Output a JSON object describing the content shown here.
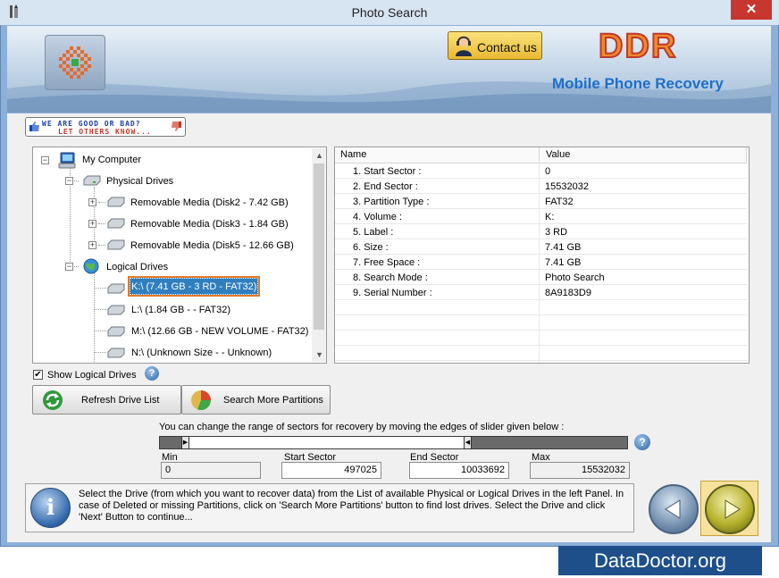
{
  "window": {
    "title": "Photo Search",
    "close_glyph": "✕"
  },
  "header": {
    "contact_label": "Contact us",
    "brand": "DDR",
    "tagline": "Mobile Phone Recovery"
  },
  "rate_badge": {
    "line1": "WE ARE GOOD OR BAD?",
    "line2": "LET OTHERS KNOW..."
  },
  "tree": {
    "root": "My Computer",
    "physical_group": "Physical Drives",
    "physical_items": [
      "Removable Media (Disk2 - 7.42 GB)",
      "Removable Media (Disk3 - 1.84 GB)",
      "Removable Media (Disk5 - 12.66 GB)"
    ],
    "logical_group": "Logical Drives",
    "logical_items": [
      "K:\\ (7.41 GB - 3 RD - FAT32)",
      "L:\\ (1.84 GB -  - FAT32)",
      "M:\\ (12.66 GB - NEW VOLUME - FAT32)",
      "N:\\ (Unknown Size  -  - Unknown)"
    ],
    "selected": "K:\\ (7.41 GB - 3 RD - FAT32)"
  },
  "properties": {
    "headers": [
      "Name",
      "Value"
    ],
    "rows": [
      [
        "1. Start Sector :",
        "0"
      ],
      [
        "2. End Sector :",
        "15532032"
      ],
      [
        "3. Partition Type :",
        "FAT32"
      ],
      [
        "4. Volume :",
        "K:"
      ],
      [
        "5. Label :",
        "3 RD"
      ],
      [
        "6. Size :",
        "7.41 GB"
      ],
      [
        "7. Free Space :",
        "7.41 GB"
      ],
      [
        "8. Search Mode :",
        "Photo Search"
      ],
      [
        "9. Serial Number :",
        "8A9183D9"
      ]
    ]
  },
  "options": {
    "show_logical_label": "Show Logical Drives",
    "show_logical_checked": true,
    "check_glyph": "✔"
  },
  "buttons": {
    "refresh": "Refresh Drive List",
    "search_more": "Search More Partitions"
  },
  "slider": {
    "hint": "You can change the range of sectors for recovery by moving the edges of slider given below :",
    "min_label": "Min",
    "start_label": "Start Sector",
    "end_label": "End Sector",
    "max_label": "Max",
    "min_value": "0",
    "start_value": "497025",
    "end_value": "10033692",
    "max_value": "15532032",
    "start_fraction": 0.032,
    "end_fraction": 0.646
  },
  "info": {
    "icon_glyph": "i",
    "text": "Select the Drive (from which you want to recover data) from the List of available Physical or Logical Drives in the left Panel. In case of Deleted or missing Partitions, click on 'Search More Partitions' button to find lost drives. Select the Drive and click 'Next' Button to continue..."
  },
  "footer": {
    "brand": "DataDoctor.org"
  },
  "colors": {
    "accent_blue": "#1d6fc9",
    "brand_orange": "#f08a2a",
    "selection_blue": "#2f7fbf",
    "selection_border": "#e07b2a",
    "footer_bg": "#1e4f8b"
  },
  "icons": {
    "app": "pen-icon",
    "logo": "checker-logo-icon",
    "contact": "support-person-icon",
    "computer": "computer-icon",
    "drive": "drive-icon",
    "globe": "globe-icon",
    "refresh": "refresh-icon",
    "search": "pie-chart-icon",
    "help": "help-icon",
    "info": "info-icon",
    "back": "back-arrow-icon",
    "next": "next-arrow-icon"
  }
}
